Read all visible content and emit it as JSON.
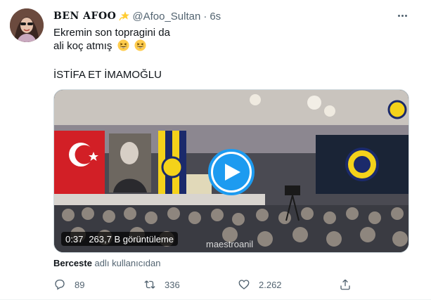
{
  "tweet": {
    "display_name": "BEN AFOO",
    "handle": "@Afoo_Sultan",
    "separator": "·",
    "time": "6s",
    "text_line1": "Ekremin son topragini da",
    "text_line2": "ali koç atmış",
    "text_line3": "İSTİFA ET İMAMOĞLU",
    "line2_emojis": [
      "grinning-squinting-face",
      "grinning-squinting-face"
    ],
    "name_badge_icon": "dizzy-star-icon"
  },
  "media": {
    "duration": "0:37",
    "views": "263,7 B görüntüleme",
    "watermark": "maestroanil",
    "play_icon": "play-icon"
  },
  "attribution": {
    "user": "Berceste",
    "suffix": " adlı kullanıcıdan"
  },
  "actions": {
    "reply_count": "89",
    "retweet_count": "336",
    "like_count": "2.262"
  },
  "colors": {
    "accent": "#1d9bf0",
    "text_primary": "#0f1419",
    "text_secondary": "#536471"
  }
}
